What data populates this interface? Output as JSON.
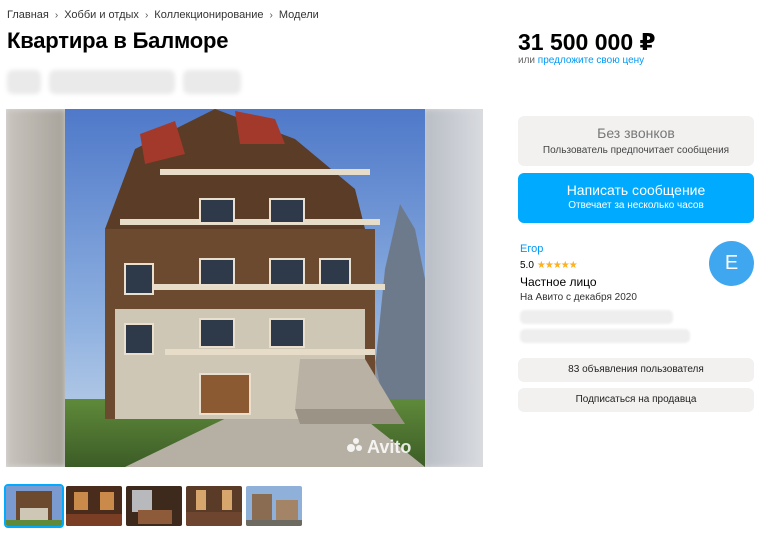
{
  "breadcrumb": [
    "Главная",
    "Хобби и отдых",
    "Коллекционирование",
    "Модели"
  ],
  "listing": {
    "title": "Квартира в Балморе",
    "watermark": "Avito"
  },
  "price": {
    "value": "31 500 000 ₽",
    "sub_prefix": "или",
    "sub_link": "предложите свою цену"
  },
  "contact": {
    "no_calls_title": "Без звонков",
    "no_calls_sub": "Пользователь предпочитает сообщения",
    "message_button": "Написать сообщение",
    "message_sub": "Отвечает за несколько часов"
  },
  "seller": {
    "name": "Егор",
    "rating": "5.0",
    "stars": "★★★★★",
    "type": "Частное лицо",
    "since": "На Авито с декабря 2020",
    "avatar_letter": "E",
    "ads_button": "83 объявления пользователя",
    "subscribe_button": "Подписаться на продавца"
  },
  "colors": {
    "accent": "#00aaff",
    "link": "#0099f7",
    "star": "#ffb021",
    "avatar": "#3fa7f0"
  },
  "icons": [
    "chevron-right-icon",
    "star-icon",
    "avito-logo-icon"
  ]
}
